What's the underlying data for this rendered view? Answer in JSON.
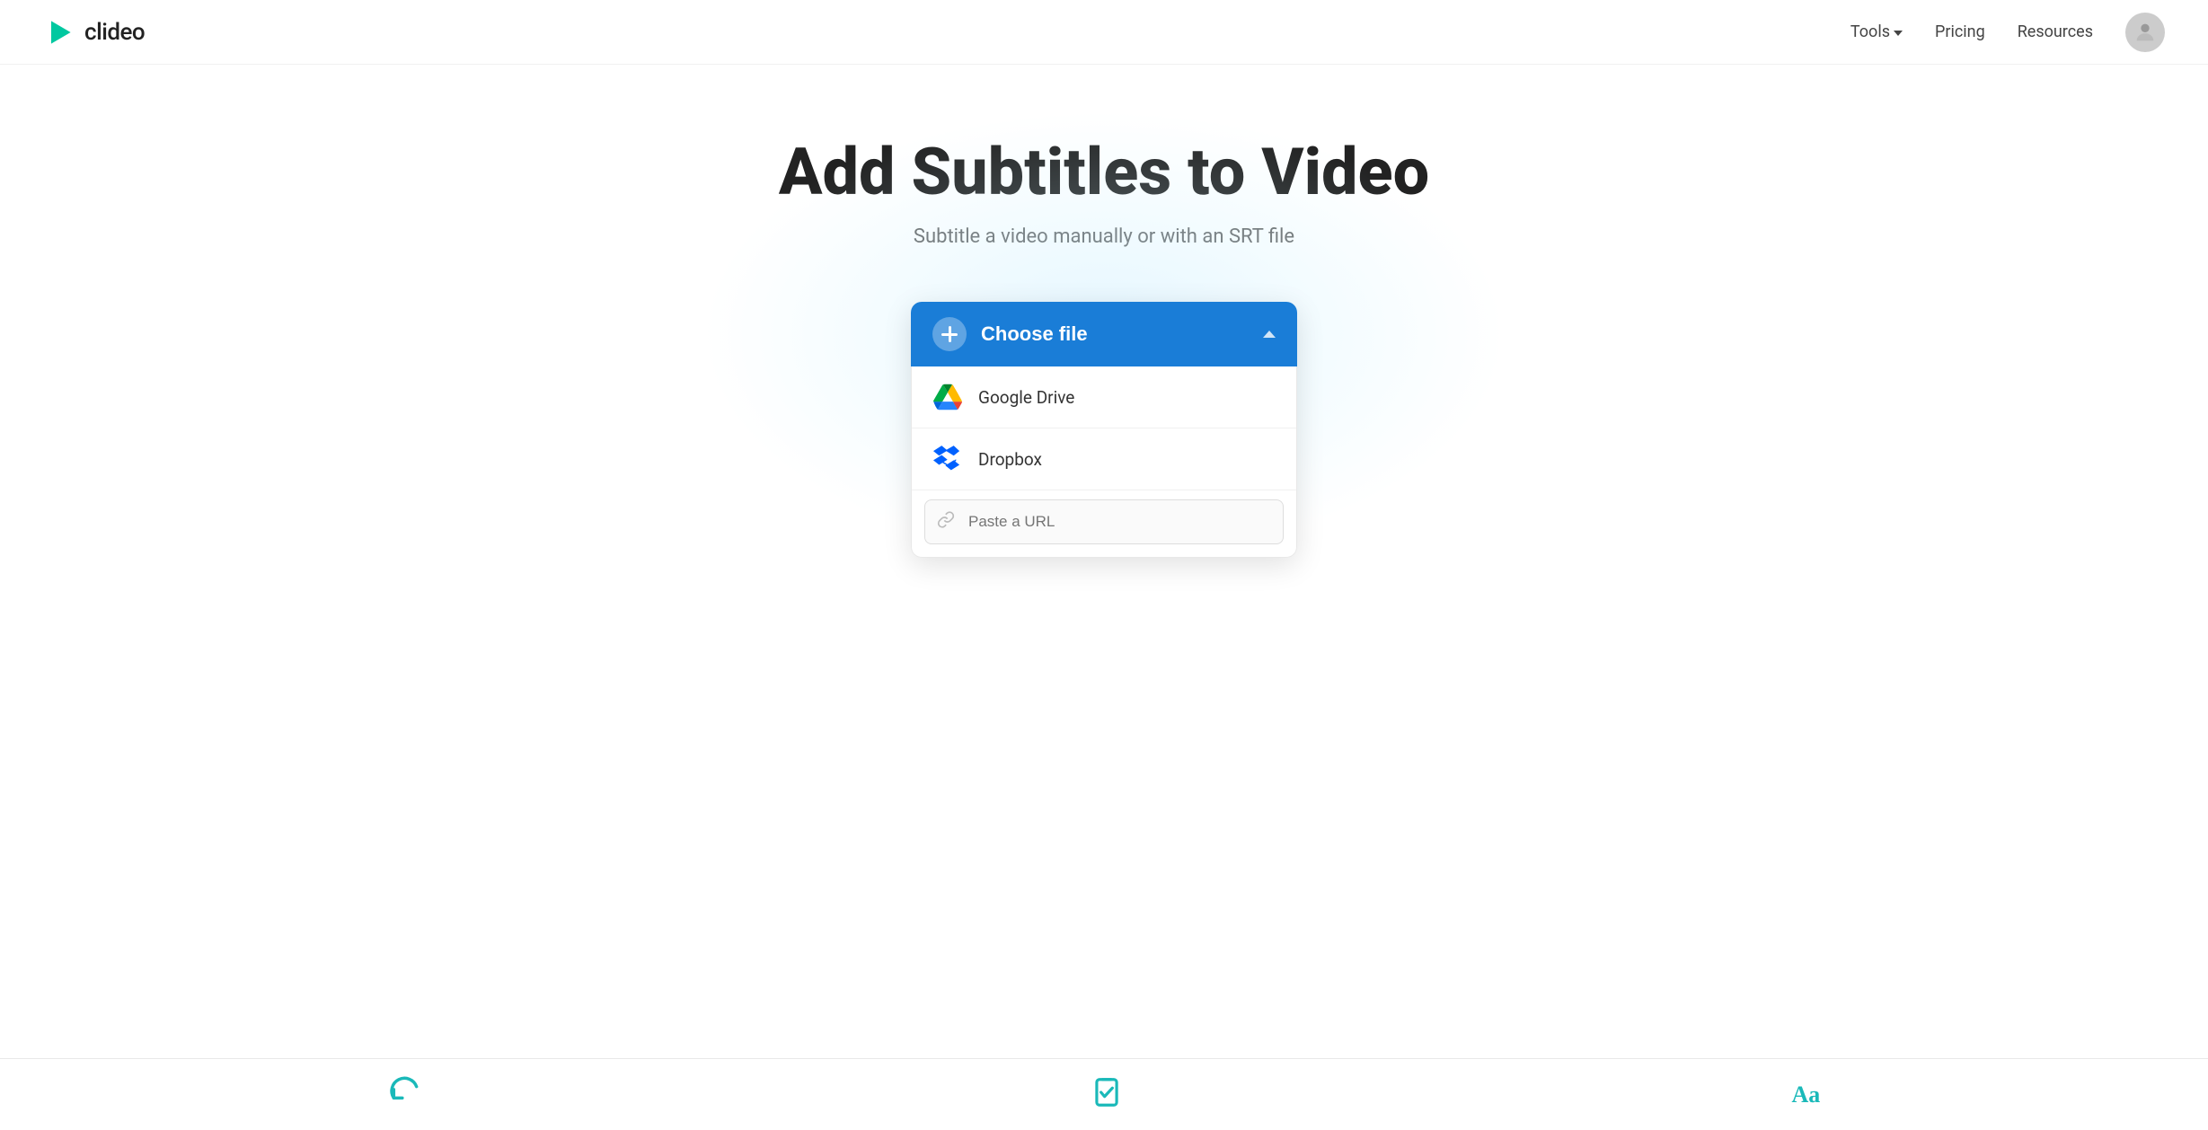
{
  "nav": {
    "logo_text": "clideo",
    "links": [
      {
        "label": "Tools",
        "has_dropdown": true
      },
      {
        "label": "Pricing",
        "has_dropdown": false
      },
      {
        "label": "Resources",
        "has_dropdown": false
      }
    ]
  },
  "hero": {
    "title": "Add Subtitles to Video",
    "subtitle": "Subtitle a video manually or with an SRT file"
  },
  "file_chooser": {
    "choose_label": "Choose file",
    "google_drive_label": "Google Drive",
    "dropbox_label": "Dropbox",
    "url_placeholder": "Paste a URL"
  },
  "bottom_bar": {
    "icons": [
      {
        "name": "rotate-icon",
        "type": "svg"
      },
      {
        "name": "clipboard-icon",
        "type": "svg"
      },
      {
        "name": "text-icon",
        "type": "text",
        "value": "Aa"
      }
    ]
  }
}
